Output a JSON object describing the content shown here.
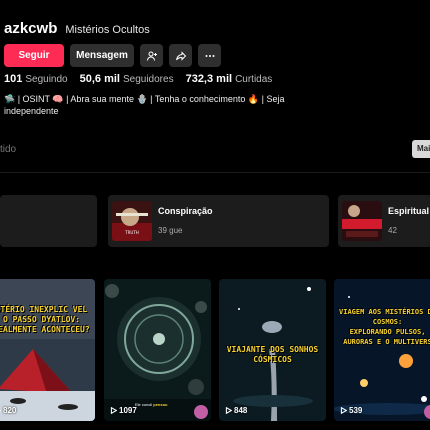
{
  "profile": {
    "username": "azkcwb",
    "display_name": "Mistérios Ocultos",
    "follow_label": "Seguir",
    "message_label": "Mensagem",
    "stats": [
      {
        "value": "101",
        "label": "Seguindo"
      },
      {
        "value": "50,6 mil",
        "label": "Seguidores"
      },
      {
        "value": "732,3 mil",
        "label": "Curtidas"
      }
    ],
    "bio": "🛸 | OSINT 🧠 | Abra sua mente 🪬 | Tenha o conhecimento 🔥 | Seja independente"
  },
  "search": {
    "partial_text": "tido",
    "more_label": "Mai"
  },
  "playlists": [
    {
      "title": "",
      "count": ""
    },
    {
      "title": "Conspiração",
      "count": "39 gue"
    },
    {
      "title": "Espiritual",
      "count": "42"
    }
  ],
  "videos": [
    {
      "title": "STÉRIO INEXPLIC VEL\nO PASSO DYATLOV:\nREALMENTE ACONTECEU?",
      "views": "820"
    },
    {
      "title": "",
      "tag_text": "Ele concil",
      "tag_highlight": "pensou",
      "views": "1097"
    },
    {
      "title": "VIAJANTE DOS SONHOS\nCÓSMICOS",
      "views": "848"
    },
    {
      "title": "VIAGEM AOS MISTÉRIOS DO\nCOSMOS:\nEXPLORANDO PULSOS,\nAURORAS E O MULTIVERS",
      "views": "539"
    }
  ],
  "colors": {
    "accent": "#fe2c55",
    "button_bg": "#2f2f2f",
    "title_yellow": "#f6d330"
  }
}
